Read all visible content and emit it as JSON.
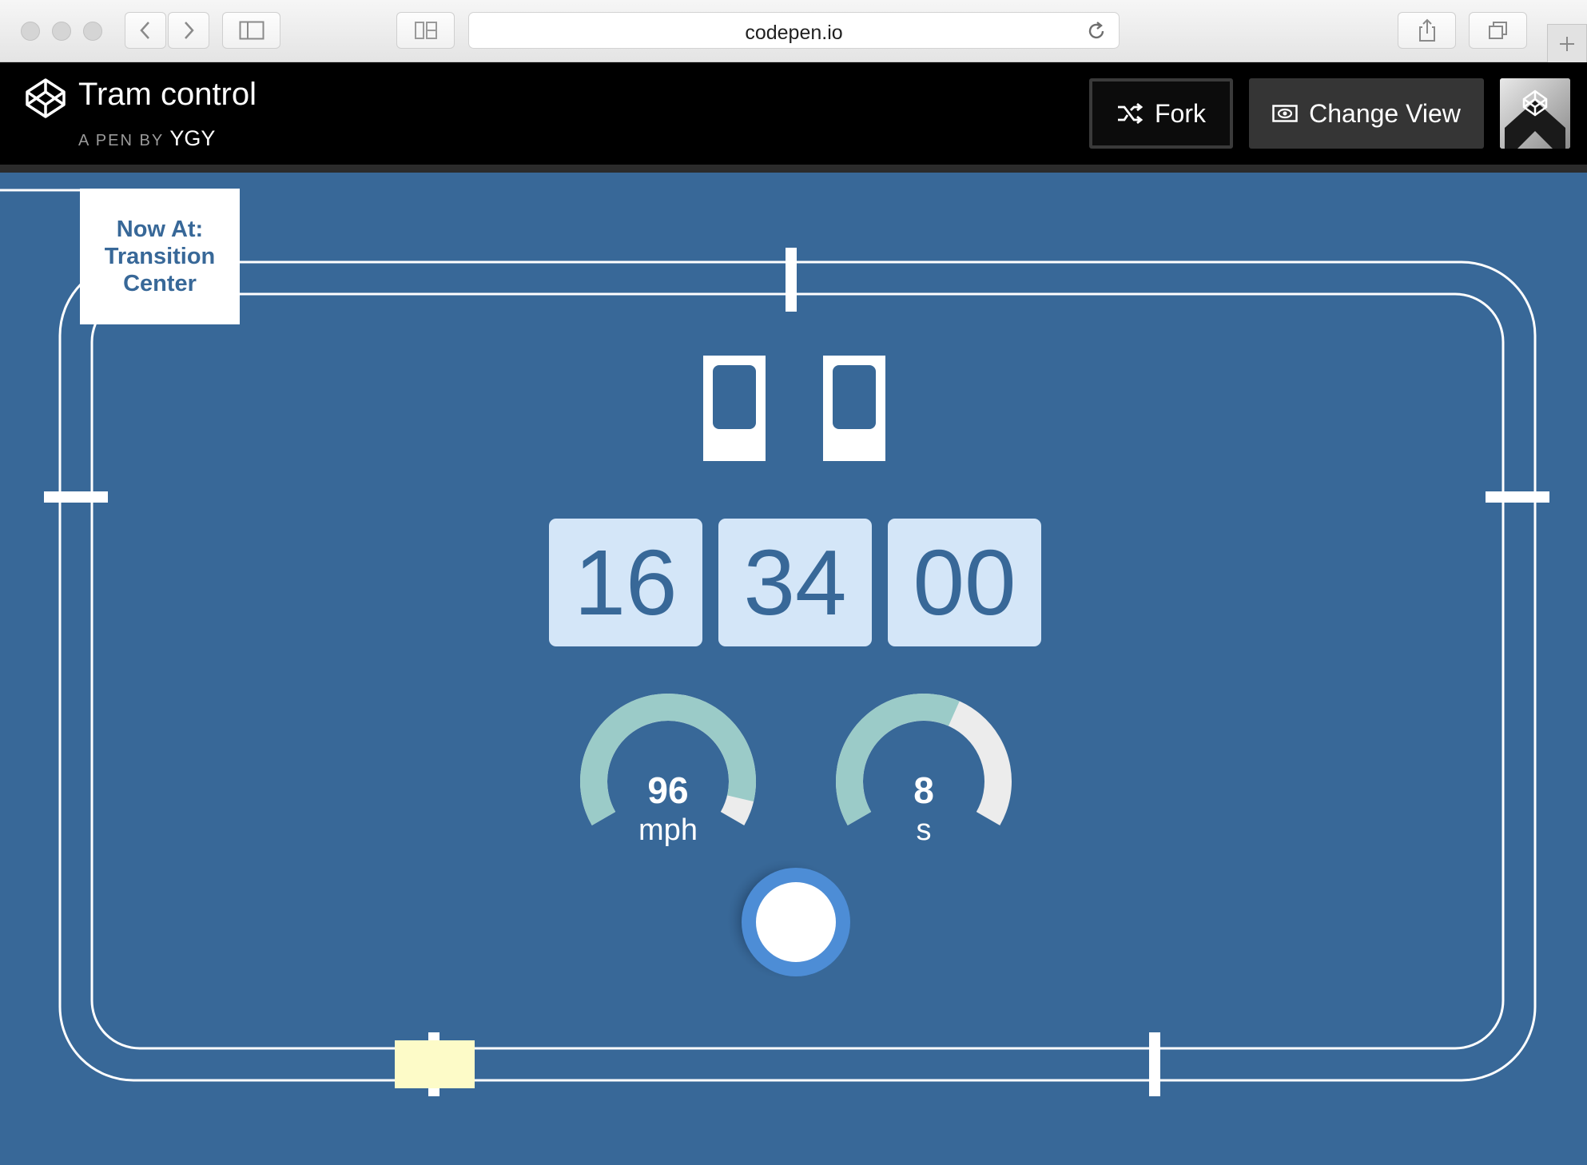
{
  "browser": {
    "url": "codepen.io"
  },
  "header": {
    "title": "Tram control",
    "byline_prefix": "A PEN BY",
    "author": "YGY",
    "fork_label": "Fork",
    "change_view_label": "Change View"
  },
  "tram": {
    "now_at_label": "Now At:",
    "station_line1": "Transition",
    "station_line2": "Center",
    "clock": {
      "hours": "16",
      "minutes": "34",
      "seconds": "00"
    },
    "speed": {
      "value": "96",
      "unit": "mph",
      "fill_fraction": 0.93
    },
    "countdown": {
      "value": "8",
      "unit": "s",
      "fill_fraction": 0.6
    }
  },
  "colors": {
    "stage_background": "#386898",
    "gauge_fill": "#9bcbc8",
    "gauge_remaining": "#ececec",
    "clock_cell": "#d4e6f8",
    "tram_car": "#fdfbc8",
    "control_ring": "#4d8dd6"
  }
}
